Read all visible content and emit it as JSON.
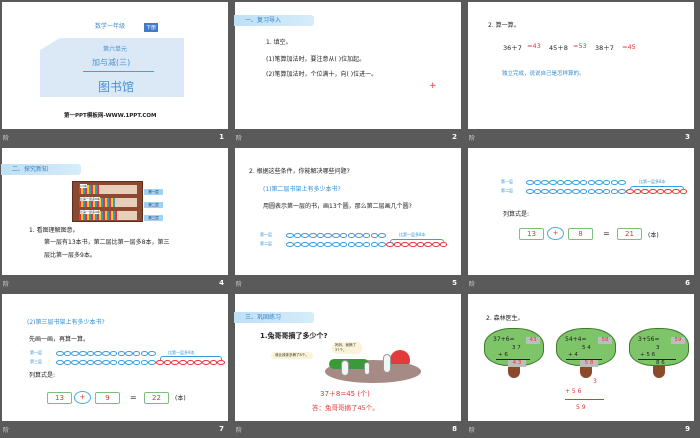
{
  "footer_label": "阶",
  "slides": [
    {
      "num": "1",
      "grade": "数学一年级",
      "badge": "下册",
      "unit": "第六单元",
      "chapter": "加与减(三)",
      "title": "图书馆",
      "site": "第一PPT模板网-WWW.1PPT.COM"
    },
    {
      "num": "2",
      "section": "一、复习导入",
      "q": "1. 填空。",
      "l1": "(1)笔算加法时，要注意从(    )位加起。",
      "l2": "(2)笔算加法时，个位满十，向(    )位进一。",
      "mark": "+"
    },
    {
      "num": "3",
      "q": "2. 算一算。",
      "e1": "36＋7",
      "a1": "=43",
      "e2": "45＋8",
      "a2": "=53",
      "e3": "38＋7",
      "a3": "=45",
      "hint": "独立完成，说说自己是怎样算的。"
    },
    {
      "num": "4",
      "section": "二、探究新知",
      "shelf": [
        "13本",
        "比第一层多8本",
        "比第一层多9本"
      ],
      "tags": [
        "第一层",
        "第二层",
        "第三层"
      ],
      "q": "1. 看图理解图意。",
      "l1": "第一层有13本书，第二层比第一层多8本，第三",
      "l2": "层比第一层多9本。"
    },
    {
      "num": "5",
      "q": "2. 根据这些条件，你能解决哪些问题?",
      "sub": "(1)第二层书架上有多少本书?",
      "l1": "用圆表示第一层的书，画13个圆，那么第二层画几个圆?",
      "row1": "第一层",
      "row2": "第二层",
      "brace": "比第一层多8本",
      "base": 13,
      "extra": 8
    },
    {
      "num": "6",
      "row1": "第一层",
      "row2": "第二层",
      "brace": "比第一层多8本",
      "base": 13,
      "extra": 8,
      "label": "列算式是:",
      "n1": "13",
      "op": "+",
      "n2": "8",
      "eq": "=",
      "res": "21",
      "unit": "(本)"
    },
    {
      "num": "7",
      "sub": "(2)第三层书架上有多少本书?",
      "l1": "先画一画，再算一算。",
      "row1": "第一层",
      "row2": "第三层",
      "brace": "比第一层多9本",
      "base": 13,
      "extra": 9,
      "label": "列算式是:",
      "n1": "13",
      "op": "+",
      "n2": "9",
      "eq": "=",
      "res": "22",
      "unit": "(本)"
    },
    {
      "num": "8",
      "section": "三、巩固练习",
      "q": "1.兔哥哥摘了多少个?",
      "b1": "我比妹妹多摘了8个。",
      "b2": "妈妈，我摘了37个。",
      "eq": "37＋8=45 (个)",
      "ans": "答：兔哥哥摘了45个。"
    },
    {
      "num": "9",
      "q": "2. 森林医生。",
      "trees": [
        {
          "expr": "37+6=",
          "box": "43",
          "top": "3 7",
          "add": "+    6",
          "res": "4 3"
        },
        {
          "expr": "54+4=",
          "box": "58",
          "top": "5 4",
          "add": "+    4",
          "res": "5 8"
        },
        {
          "expr": "3+56=",
          "box": "59",
          "top": "3",
          "add": "+  5 6",
          "res": "8 6"
        }
      ],
      "fix": {
        "top": "3",
        "add": "+  5  6",
        "res": "5    9"
      }
    }
  ]
}
